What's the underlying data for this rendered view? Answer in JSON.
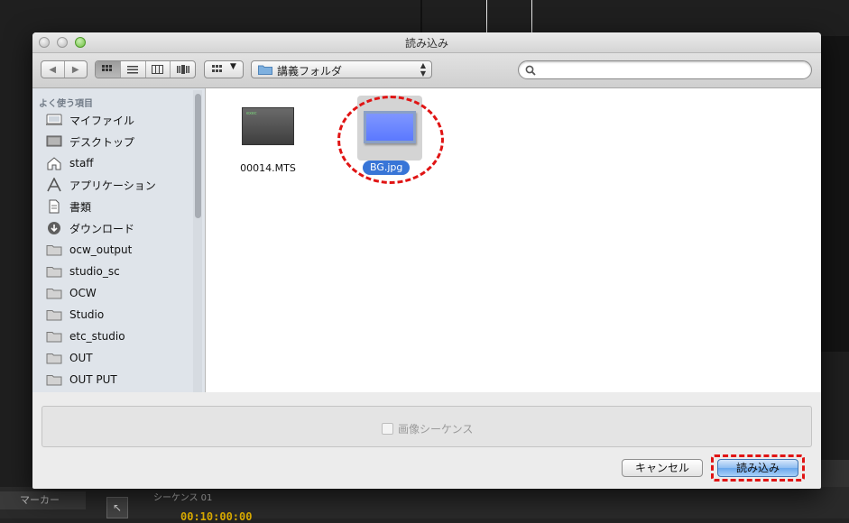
{
  "background": {
    "marker_tab": "マーカー",
    "sequence_tab": "シーケンス 01",
    "timecode": "00:10:00:00"
  },
  "dialog": {
    "title": "読み込み",
    "toolbar": {
      "back_label": "◀",
      "forward_label": "▶",
      "view_icon": "icon-view",
      "view_list": "list-view",
      "view_column": "column-view",
      "view_coverflow": "coverflow-view",
      "location": "講義フォルダ",
      "search_placeholder": ""
    },
    "sidebar": {
      "heading": "よく使う項目",
      "items": [
        {
          "label": "マイファイル",
          "icon": "all-files-icon"
        },
        {
          "label": "デスクトップ",
          "icon": "desktop-icon"
        },
        {
          "label": "staff",
          "icon": "home-icon"
        },
        {
          "label": "アプリケーション",
          "icon": "applications-icon"
        },
        {
          "label": "書類",
          "icon": "documents-icon"
        },
        {
          "label": "ダウンロード",
          "icon": "downloads-icon"
        },
        {
          "label": "ocw_output",
          "icon": "folder-icon"
        },
        {
          "label": "studio_sc",
          "icon": "folder-icon"
        },
        {
          "label": "OCW",
          "icon": "folder-icon"
        },
        {
          "label": "Studio",
          "icon": "folder-icon"
        },
        {
          "label": "etc_studio",
          "icon": "folder-icon"
        },
        {
          "label": "OUT",
          "icon": "folder-icon"
        },
        {
          "label": "OUT PUT",
          "icon": "folder-icon"
        }
      ]
    },
    "files": [
      {
        "name": "00014.MTS",
        "selected": false,
        "thumb_text": "exec"
      },
      {
        "name": "BG.jpg",
        "selected": true
      }
    ],
    "options": {
      "image_sequence_label": "画像シーケンス",
      "image_sequence_checked": false
    },
    "buttons": {
      "cancel": "キャンセル",
      "open": "読み込み"
    },
    "colors": {
      "selection": "#3875d7",
      "annotation": "#e01414"
    }
  }
}
